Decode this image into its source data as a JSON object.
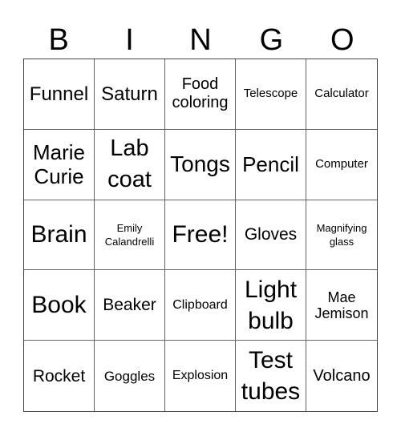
{
  "header": {
    "letters": [
      "B",
      "I",
      "N",
      "G",
      "O"
    ]
  },
  "cells": [
    {
      "text": "Funnel"
    },
    {
      "text": "Saturn"
    },
    {
      "text": "Food coloring"
    },
    {
      "text": "Telescope"
    },
    {
      "text": "Calculator"
    },
    {
      "text": "Marie Curie"
    },
    {
      "text": "Lab coat"
    },
    {
      "text": "Tongs"
    },
    {
      "text": "Pencil"
    },
    {
      "text": "Computer"
    },
    {
      "text": "Brain"
    },
    {
      "text": "Emily Calandrelli"
    },
    {
      "text": "Free!"
    },
    {
      "text": "Gloves"
    },
    {
      "text": "Magnifying glass"
    },
    {
      "text": "Book"
    },
    {
      "text": "Beaker"
    },
    {
      "text": "Clipboard"
    },
    {
      "text": "Light bulb"
    },
    {
      "text": "Mae Jemison"
    },
    {
      "text": "Rocket"
    },
    {
      "text": "Goggles"
    },
    {
      "text": "Explosion"
    },
    {
      "text": "Test tubes"
    },
    {
      "text": "Volcano"
    }
  ]
}
